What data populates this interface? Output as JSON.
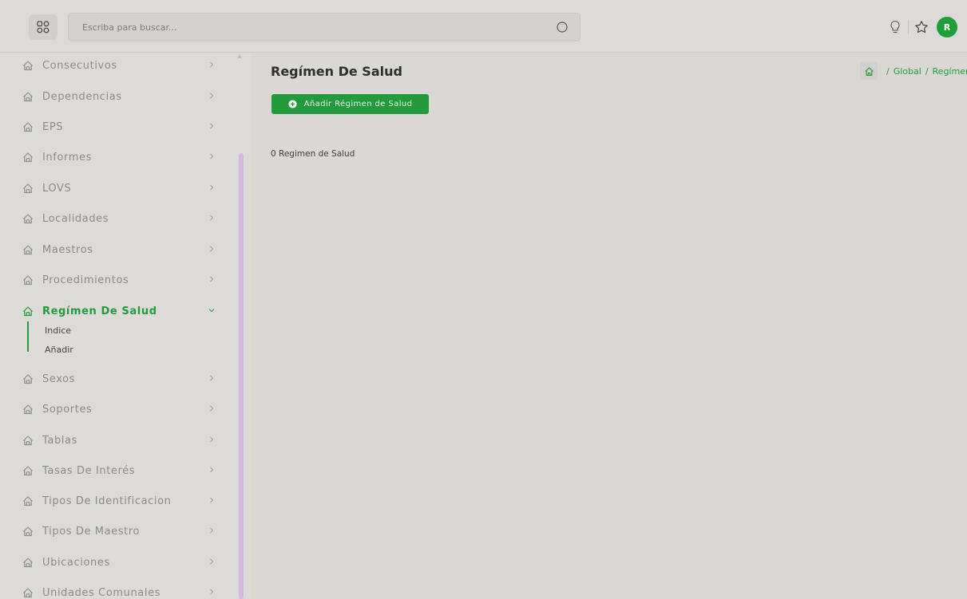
{
  "search": {
    "placeholder": "Escriba para buscar..."
  },
  "user": {
    "avatar_initial": "R"
  },
  "sidebar": {
    "items": [
      {
        "label": "Consecutivos"
      },
      {
        "label": "Dependencias"
      },
      {
        "label": "EPS"
      },
      {
        "label": "Informes"
      },
      {
        "label": "LOVS"
      },
      {
        "label": "Localidades"
      },
      {
        "label": "Maestros"
      },
      {
        "label": "Procedimientos"
      },
      {
        "label": "Regímen De Salud",
        "active": true,
        "expanded": true,
        "children": [
          {
            "label": "Indice"
          },
          {
            "label": "Añadir"
          }
        ]
      },
      {
        "label": "Sexos"
      },
      {
        "label": "Soportes"
      },
      {
        "label": "Tablas"
      },
      {
        "label": "Tasas De Interés"
      },
      {
        "label": "Tipos De Identificacion"
      },
      {
        "label": "Tipos De Maestro"
      },
      {
        "label": "Ubicaciones"
      },
      {
        "label": "Unidades Comunales"
      }
    ]
  },
  "main": {
    "title": "Regímen De Salud",
    "breadcrumb": [
      "Global",
      "Regímen De Salud"
    ],
    "add_button_label": "Añadir Régimen de Salud",
    "count_text": "0 Regimen de Salud"
  },
  "colors": {
    "accent": "#239b3c",
    "background": "#d9d8d4",
    "scroll_thumb": "#d4b8df"
  }
}
